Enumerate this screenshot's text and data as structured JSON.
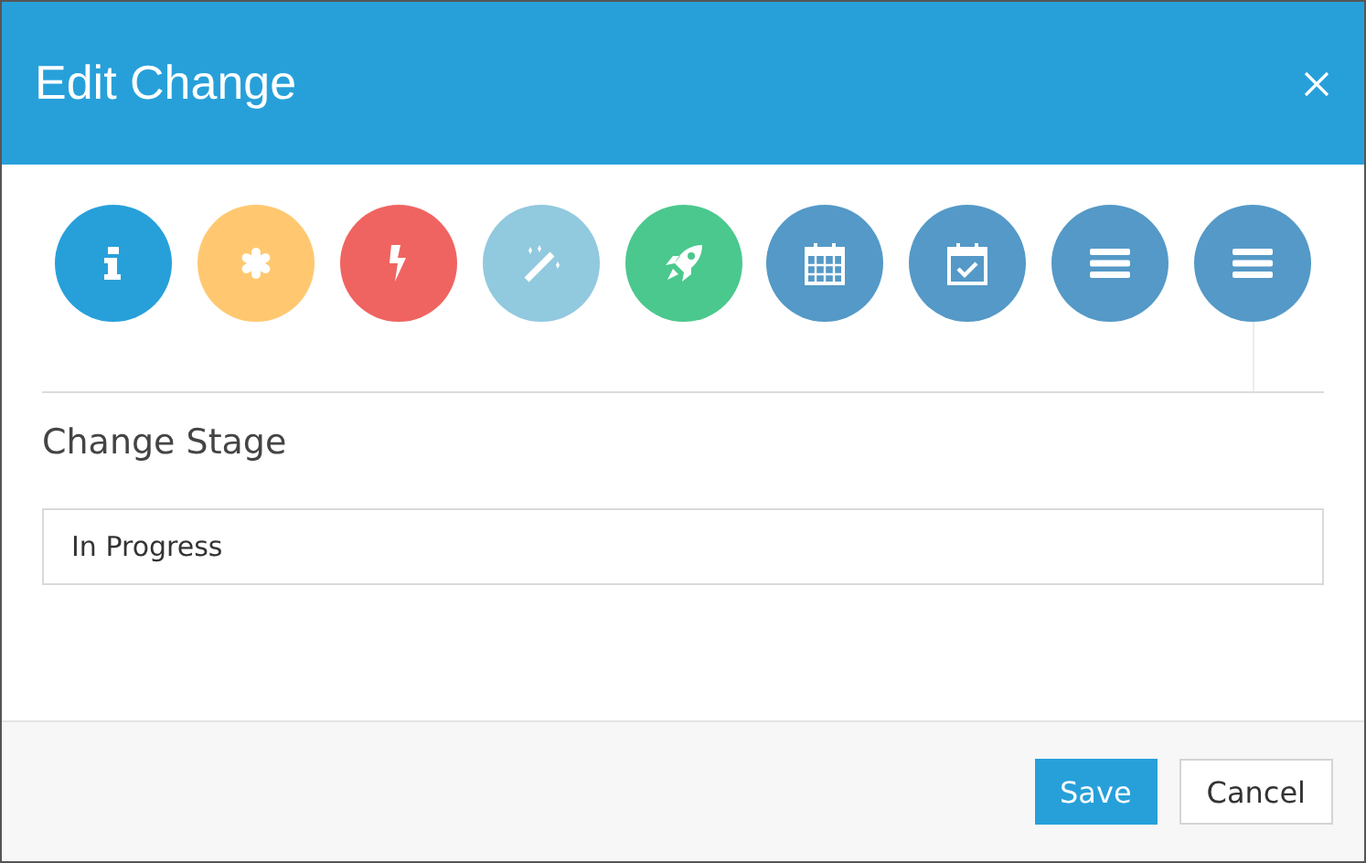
{
  "dialog": {
    "title": "Edit Change"
  },
  "steps": [
    {
      "kind": "info",
      "color": "#27a0da"
    },
    {
      "kind": "asterisk",
      "color": "#ffc870"
    },
    {
      "kind": "bolt",
      "color": "#ef6461"
    },
    {
      "kind": "wand",
      "color": "#91c9df"
    },
    {
      "kind": "rocket",
      "color": "#4bc88d"
    },
    {
      "kind": "calendar",
      "color": "#5499c7"
    },
    {
      "kind": "calendar-check",
      "color": "#5499c7"
    },
    {
      "kind": "list",
      "color": "#5499c7"
    },
    {
      "kind": "list",
      "color": "#5499c7"
    }
  ],
  "section": {
    "heading": "Change Stage",
    "field": {
      "value": "In Progress"
    }
  },
  "buttons": [
    {
      "label": "Save",
      "kind": "primary"
    },
    {
      "label": "Cancel",
      "kind": "default"
    }
  ]
}
